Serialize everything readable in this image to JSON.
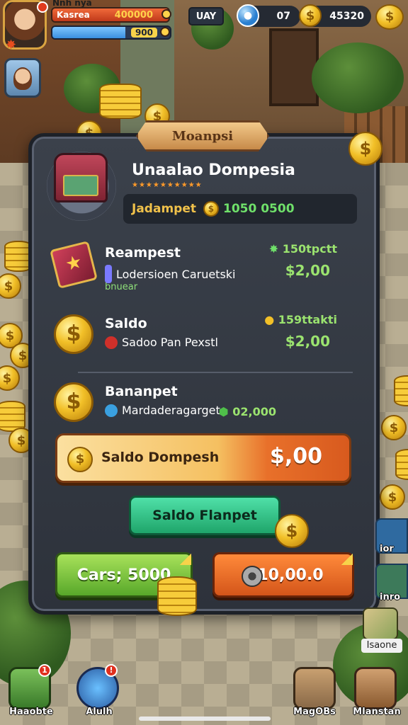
{
  "hud": {
    "player_name": "Nnh nya",
    "hp_label": "Kasrea",
    "hp_value": "400000",
    "hp_fraction": 0.92,
    "xp_value": "900",
    "xp_fraction": 0.62,
    "day_label": "UAY",
    "gems": "07",
    "coins": "45320"
  },
  "panel": {
    "title": "Moanpsi",
    "shop_title": "Unaalao Dompesia",
    "stars": "★★★★★★★★★★",
    "balance_label": "Jadampet",
    "balance_value": "1050 0500"
  },
  "items": [
    {
      "name": "Reampest",
      "desc": "Lodersioen Caruetski",
      "sub": "bnuear",
      "rate": "150tpctt",
      "price": "$2,00"
    },
    {
      "name": "Saldo",
      "desc": "Sadoo Pan Pexstl",
      "rate": "159ttakti",
      "price": "$2,00"
    },
    {
      "name": "Bananpet",
      "desc": "Mardaderagarget",
      "rate": "02,000"
    }
  ],
  "buttons": {
    "wide_label": "Saldo Dompesh",
    "wide_amount": "$,00",
    "green_label": "Saldo Flanpet",
    "lime_label": "Cars; 5000",
    "orange_label": "10,00.0"
  },
  "side_labels": {
    "right_1": "ior",
    "right_2": "inro",
    "map": "Isaone"
  },
  "bottom_nav": [
    {
      "label": "Haaobte",
      "badge": "1"
    },
    {
      "label": "Alulh",
      "badge": "!"
    },
    {
      "label": "MagOBs"
    },
    {
      "label": "Mlanstan"
    }
  ],
  "colors": {
    "panel_bg": "#3b414b",
    "accent_gold": "#f2c028",
    "price_green": "#9be36f",
    "hp_red": "#c0391a",
    "xp_blue": "#3a8fe0"
  },
  "icons": {
    "currency": "coin-icon",
    "premium": "gem-icon",
    "shop": "chest-icon"
  }
}
